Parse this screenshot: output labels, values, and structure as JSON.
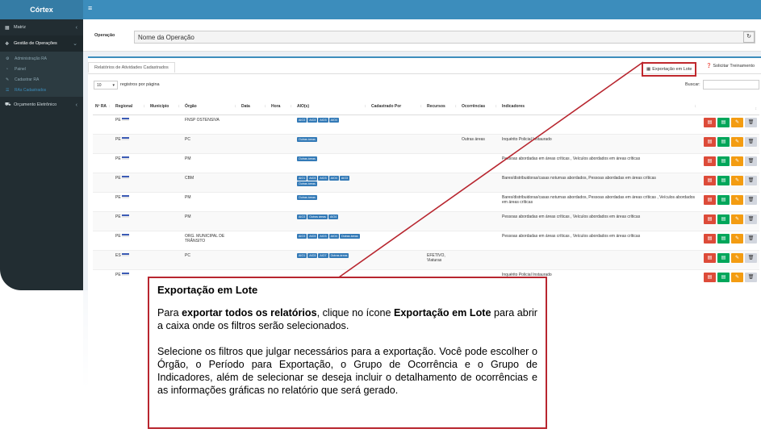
{
  "app": {
    "brand": "Córtex",
    "menu_icon": "hamburger-icon"
  },
  "sidebar": {
    "items": [
      {
        "label": "Matriz",
        "icon": "grid-icon"
      },
      {
        "label": "Gestão de Operações",
        "icon": "cubes-icon"
      },
      {
        "label": "Orçamento Eletrônico",
        "icon": "car-icon"
      }
    ],
    "subitems": [
      {
        "label": "Administração RA",
        "icon": "cogs-icon"
      },
      {
        "label": "Painel",
        "icon": "dashboard-icon"
      },
      {
        "label": "Cadastrar RA",
        "icon": "edit-icon"
      },
      {
        "label": "RAs Cadastrados",
        "icon": "list-icon"
      }
    ]
  },
  "operation": {
    "label": "Operação",
    "value": "Nome da Operação"
  },
  "panel": {
    "tab": "Relatórios de Atividades Cadastrados",
    "export_label": "Exportação em Lote",
    "training_label": "Solicitar Treinamento",
    "page_size": "10",
    "page_size_text": "registros por página",
    "search_label": "Buscar:"
  },
  "table": {
    "headers": [
      "Nº RA",
      "Regional",
      "Município",
      "Órgão",
      "Data",
      "Hora",
      "AIO(s)",
      "Cadastrado Por",
      "Recursos",
      "Ocorrências",
      "Indicadores",
      ""
    ],
    "rows": [
      {
        "regional": "PE",
        "orgao": "FNSP OSTENSIVA",
        "aios": [
          "AIO3",
          "AIO3",
          "AIO3",
          "AIO4"
        ],
        "recursos": "",
        "ocorrencias": "",
        "indicadores": ""
      },
      {
        "regional": "PE",
        "orgao": "PC",
        "aios": [
          "Outras áreas"
        ],
        "recursos": "",
        "ocorrencias": "Outras áreas",
        "indicadores": "Inquérito Policial Instaurado"
      },
      {
        "regional": "PE",
        "orgao": "PM",
        "aios": [
          "Outras áreas"
        ],
        "recursos": "",
        "ocorrencias": "",
        "indicadores": "Pessoas abordadas em áreas críticas , Veículos abordados em áreas críticas"
      },
      {
        "regional": "PE",
        "orgao": "CBM",
        "aios": [
          "AIO1",
          "AIO3",
          "AIO3",
          "AIO4",
          "AIO3",
          "Outras áreas"
        ],
        "recursos": "",
        "ocorrencias": "",
        "indicadores": "Bares/distribuidoras/casas noturnas abordados, Pessoas abordadas em áreas críticas"
      },
      {
        "regional": "PE",
        "orgao": "PM",
        "aios": [
          "Outras áreas"
        ],
        "recursos": "",
        "ocorrencias": "",
        "indicadores": "Bares/distribuidoras/casas noturnas abordados, Pessoas abordadas em áreas críticas , Veículos abordados em áreas críticas"
      },
      {
        "regional": "PE",
        "orgao": "PM",
        "aios": [
          "AIO3",
          "Outras áreas",
          "AIO4"
        ],
        "recursos": "",
        "ocorrencias": "",
        "indicadores": "Pessoas abordadas em áreas críticas , Veículos abordados em áreas críticas"
      },
      {
        "regional": "PE",
        "orgao": "ORG. MUNICIPAL DE TRÂNSITO",
        "aios": [
          "AIO3",
          "AIO3",
          "AIO3",
          "AIO4",
          "Outras áreas"
        ],
        "recursos": "",
        "ocorrencias": "",
        "indicadores": "Pessoas abordadas em áreas críticas , Veículos abordados em áreas críticas"
      },
      {
        "regional": "ES",
        "orgao": "PC",
        "aios": [
          "AIO1",
          "AIO3",
          "AIO7",
          "Outras áreas"
        ],
        "recursos": "EFETIVO, Viaturas",
        "ocorrencias": "",
        "indicadores": ""
      },
      {
        "regional": "PE",
        "orgao": "",
        "aios": [],
        "recursos": "",
        "ocorrencias": "",
        "indicadores": "Inquérito Policial Instaurado"
      }
    ]
  },
  "callout": {
    "title": "Exportação em Lote",
    "p1_a": "Para ",
    "p1_b": "exportar todos os relatórios",
    "p1_c": ", clique no ícone ",
    "p1_d": "Exportação em Lote",
    "p1_e": " para abrir a caixa onde os filtros serão selecionados.",
    "p2": "Selecione os filtros que julgar necessários para a exportação. Você pode escolher o Órgão, o Período para Exportação, o Grupo de Ocorrência e o Grupo de Indicadores, além de selecionar se deseja incluir o detalhamento de ocorrências e as informações gráficas no relatório que será gerado."
  },
  "colors": {
    "accent": "#3c8dbc",
    "sidebar": "#222d32",
    "callout_border": "#b8262f"
  }
}
